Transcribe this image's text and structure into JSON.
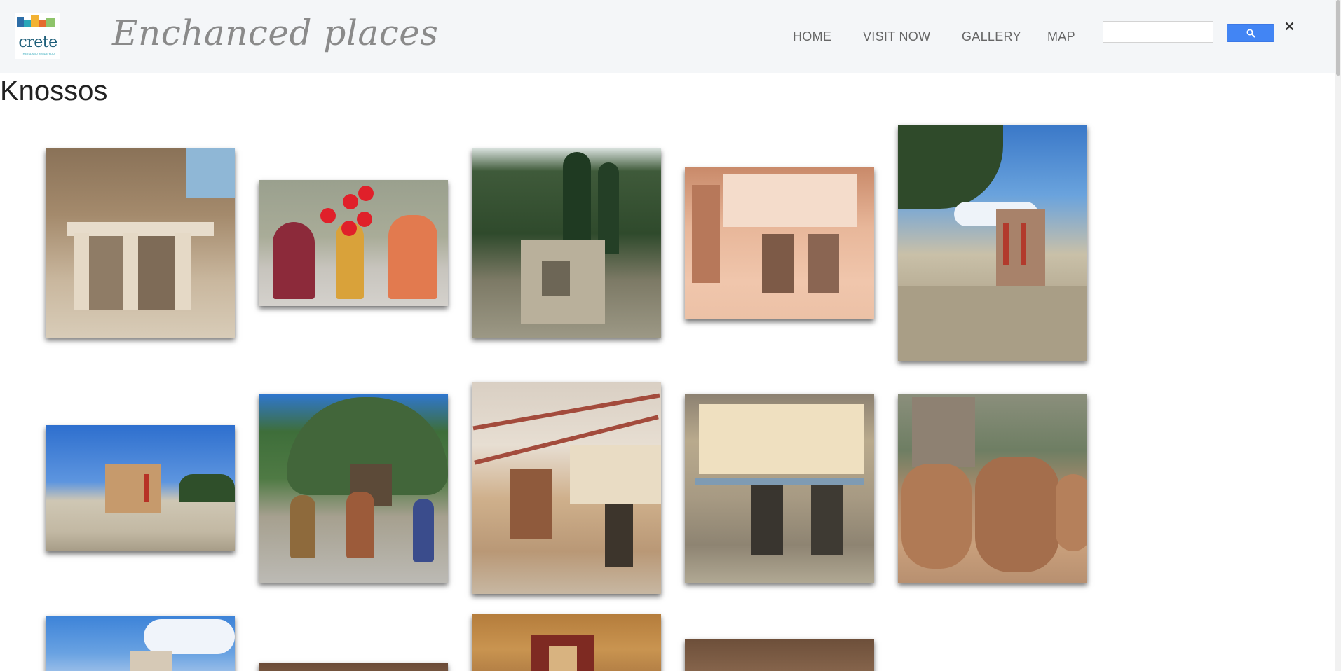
{
  "header": {
    "logo": {
      "word": "crete",
      "tagline": "THE ISLAND INSIDE YOU"
    },
    "brand": "Enchanced places",
    "nav": [
      {
        "label": "HOME"
      },
      {
        "label": "VISIT NOW"
      },
      {
        "label": "GALLERY"
      },
      {
        "label": "MAP"
      }
    ],
    "search": {
      "value": "",
      "placeholder": "",
      "button_icon": "search-icon",
      "clear_glyph": "✕"
    }
  },
  "page": {
    "title": "Knossos"
  },
  "gallery": {
    "images": [
      {
        "subject": "Ruins doorway with two visitors"
      },
      {
        "subject": "Dancers with red balls"
      },
      {
        "subject": "Ruins among cypress trees"
      },
      {
        "subject": "Dolphin fresco room (warm tint)"
      },
      {
        "subject": "North entrance with red columns"
      },
      {
        "subject": "North entrance landscape"
      },
      {
        "subject": "Warriors dance under olive tree"
      },
      {
        "subject": "Queen's megaron corner"
      },
      {
        "subject": "Dolphin fresco"
      },
      {
        "subject": "Large clay pithoi"
      },
      {
        "subject": "Palace under clouds"
      },
      {
        "subject": "Interior detail"
      },
      {
        "subject": "Fresco frame"
      },
      {
        "subject": "Interior ceiling"
      }
    ]
  },
  "colors": {
    "header_bg": "#f4f6f8",
    "nav_text": "#666666",
    "search_button": "#4285f4",
    "brand_text": "#8a8a8a"
  }
}
